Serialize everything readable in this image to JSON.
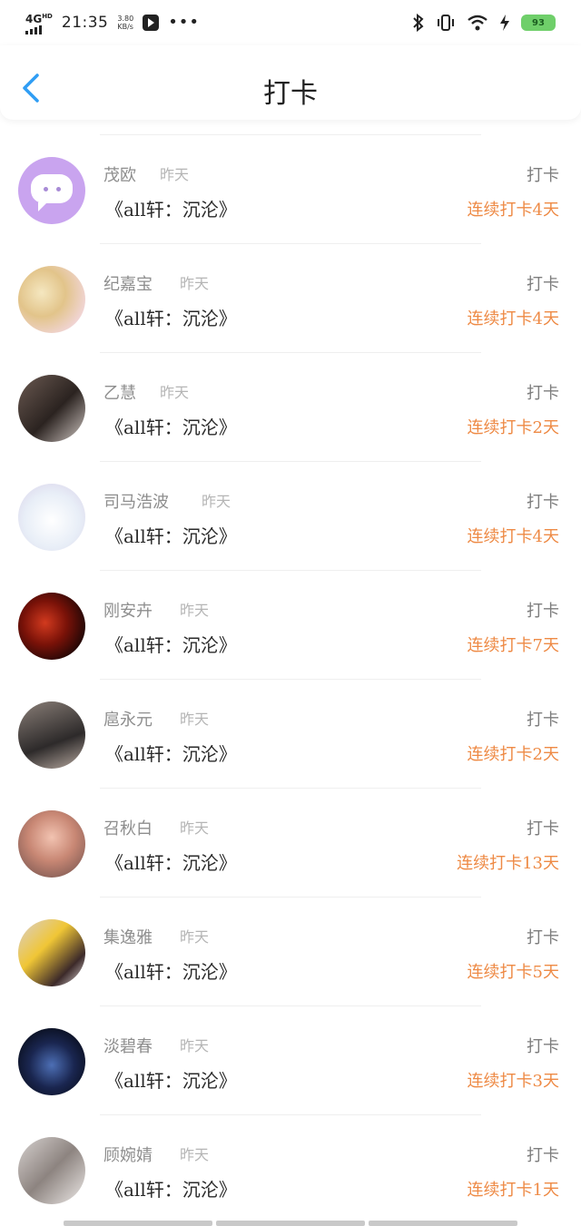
{
  "status_bar": {
    "network": "4G",
    "network_sup": "HD",
    "time": "21:35",
    "speed_value": "3.80",
    "speed_unit": "KB/s",
    "battery": "93"
  },
  "header": {
    "title": "打卡"
  },
  "items": [
    {
      "name": "茂欧",
      "time": "昨天",
      "book": "《all轩：沉沦》",
      "action": "打卡",
      "streak": "连续打卡4天"
    },
    {
      "name": "纪嘉宝",
      "time": "昨天",
      "book": "《all轩：沉沦》",
      "action": "打卡",
      "streak": "连续打卡4天"
    },
    {
      "name": "乙慧",
      "time": "昨天",
      "book": "《all轩：沉沦》",
      "action": "打卡",
      "streak": "连续打卡2天"
    },
    {
      "name": "司马浩波",
      "time": "昨天",
      "book": "《all轩：沉沦》",
      "action": "打卡",
      "streak": "连续打卡4天"
    },
    {
      "name": "刚安卉",
      "time": "昨天",
      "book": "《all轩：沉沦》",
      "action": "打卡",
      "streak": "连续打卡7天"
    },
    {
      "name": "扈永元",
      "time": "昨天",
      "book": "《all轩：沉沦》",
      "action": "打卡",
      "streak": "连续打卡2天"
    },
    {
      "name": "召秋白",
      "time": "昨天",
      "book": "《all轩：沉沦》",
      "action": "打卡",
      "streak": "连续打卡13天"
    },
    {
      "name": "集逸雅",
      "time": "昨天",
      "book": "《all轩：沉沦》",
      "action": "打卡",
      "streak": "连续打卡5天"
    },
    {
      "name": "淡碧春",
      "time": "昨天",
      "book": "《all轩：沉沦》",
      "action": "打卡",
      "streak": "连续打卡3天"
    },
    {
      "name": "顾婉婧",
      "time": "昨天",
      "book": "《all轩：沉沦》",
      "action": "打卡",
      "streak": "连续打卡1天"
    }
  ],
  "colors": {
    "accent_blue": "#2f9df4",
    "streak_orange": "#ee8a45",
    "name_gray": "#8e8e8e",
    "battery_green": "#6fcf6a"
  },
  "icons": {
    "back": "chevron-left-icon",
    "bluetooth": "bluetooth-icon",
    "vibrate": "vibrate-icon",
    "wifi": "wifi-icon",
    "charging": "charging-icon",
    "battery": "battery-icon",
    "app": "video-app-icon",
    "more": "more-dots-icon"
  }
}
